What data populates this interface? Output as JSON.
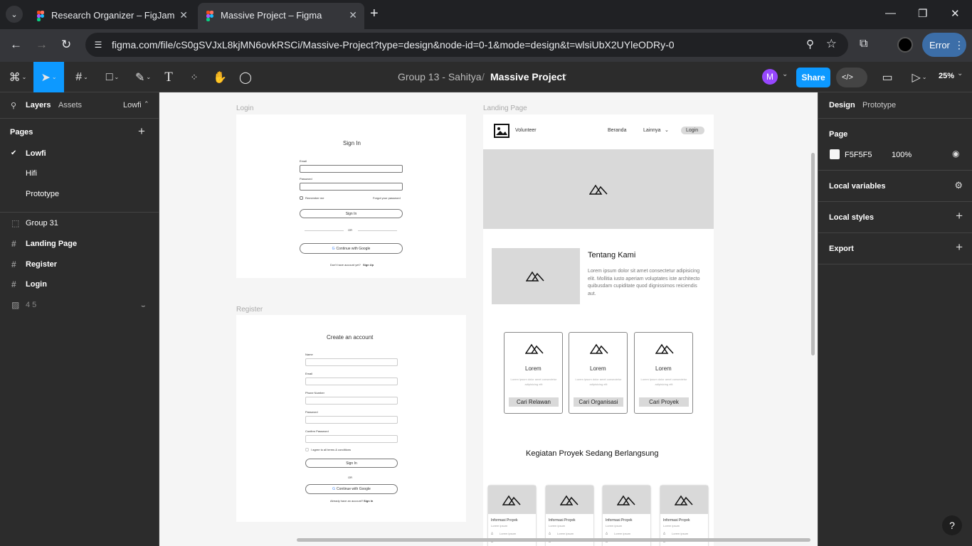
{
  "browser": {
    "tabs": [
      {
        "title": "Research Organizer – FigJam",
        "active": false
      },
      {
        "title": "Massive Project – Figma",
        "active": true
      }
    ],
    "url": "figma.com/file/cS0gSVJxL8kjMN6ovkRSCi/Massive-Project?type=design&node-id=0-1&mode=design&t=wlsiUbX2UYleODRy-0",
    "error_label": "Error"
  },
  "toolbar": {
    "team": "Group 13 - Sahitya",
    "separator": "/",
    "file_name": "Massive Project",
    "avatar_initial": "M",
    "share_label": "Share",
    "zoom": "25%"
  },
  "left_panel": {
    "tabs": [
      "Layers",
      "Assets"
    ],
    "current_page": "Lowfi",
    "pages_heading": "Pages",
    "pages": [
      "Lowfi",
      "Hifi",
      "Prototype"
    ],
    "layers": [
      {
        "name": "Group 31",
        "icon": "group-icon"
      },
      {
        "name": "Landing Page",
        "icon": "frame-icon"
      },
      {
        "name": "Register",
        "icon": "frame-icon"
      },
      {
        "name": "Login",
        "icon": "frame-icon"
      },
      {
        "name": "4 5",
        "icon": "image-icon"
      }
    ]
  },
  "canvas": {
    "login": {
      "label": "Login",
      "title": "Sign In",
      "email": "Email",
      "password": "Password",
      "remember": "Remember me",
      "forgot": "Forgot your password",
      "signin": "Sign In",
      "or": "OR",
      "google": "Continue with Google",
      "no_account": "Don't have account yet?",
      "signup": "Sign Up"
    },
    "register": {
      "label": "Register",
      "title": "Create an account",
      "fields": [
        "Name",
        "Email",
        "Phone Number",
        "Password",
        "Confirm Password"
      ],
      "agree": "I agree to all terms & conditions",
      "signin": "Sign In",
      "or": "OR",
      "google": "Continue with Google",
      "have_account": "Already have an account?",
      "signin_link": "Sign In"
    },
    "landing": {
      "label": "Landing Page",
      "brand": "Volunteer",
      "nav": [
        "Beranda",
        "Lainnya"
      ],
      "login": "Login",
      "about_title": "Tentang Kami",
      "about_text": "Lorem ipsum dolor sit amet consectetur adipisicing elit. Mollitia iusto aperiam voluptates iste architecto quibusdam cupiditate quod dignissimos reiciendis aut.",
      "cards": [
        {
          "title": "Lorem",
          "text": "Lorem ipsum dolor amet consectetur adipisicing elit",
          "button": "Cari Relawan"
        },
        {
          "title": "Lorem",
          "text": "Lorem ipsum dolor amet consectetur adipisicing elit",
          "button": "Cari Organisasi"
        },
        {
          "title": "Lorem",
          "text": "Lorem ipsum dolor amet consectetur adipisicing elit",
          "button": "Cari Proyek"
        }
      ],
      "projects_title": "Kegiatan Proyek Sedang Berlangsung",
      "projects": [
        {
          "title": "Informasi Proyek",
          "sub": "Lorem ipsum",
          "line": "Lorem ipsum"
        },
        {
          "title": "Informasi Proyek",
          "sub": "Lorem ipsum",
          "line": "Lorem ipsum"
        },
        {
          "title": "Informasi Proyek",
          "sub": "Lorem ipsum",
          "line": "Lorem ipsum"
        },
        {
          "title": "Informasi Proyek",
          "sub": "Lorem ipsum",
          "line": "Lorem ipsum"
        }
      ]
    }
  },
  "right_panel": {
    "tabs": [
      "Design",
      "Prototype"
    ],
    "page_heading": "Page",
    "page_color": "F5F5F5",
    "page_opacity": "100%",
    "sections": [
      "Local variables",
      "Local styles",
      "Export"
    ]
  },
  "colors": {
    "accent": "#0d99ff",
    "canvas": "#f5f5f5",
    "panel": "#2c2c2c",
    "avatar": "#9747ff"
  }
}
